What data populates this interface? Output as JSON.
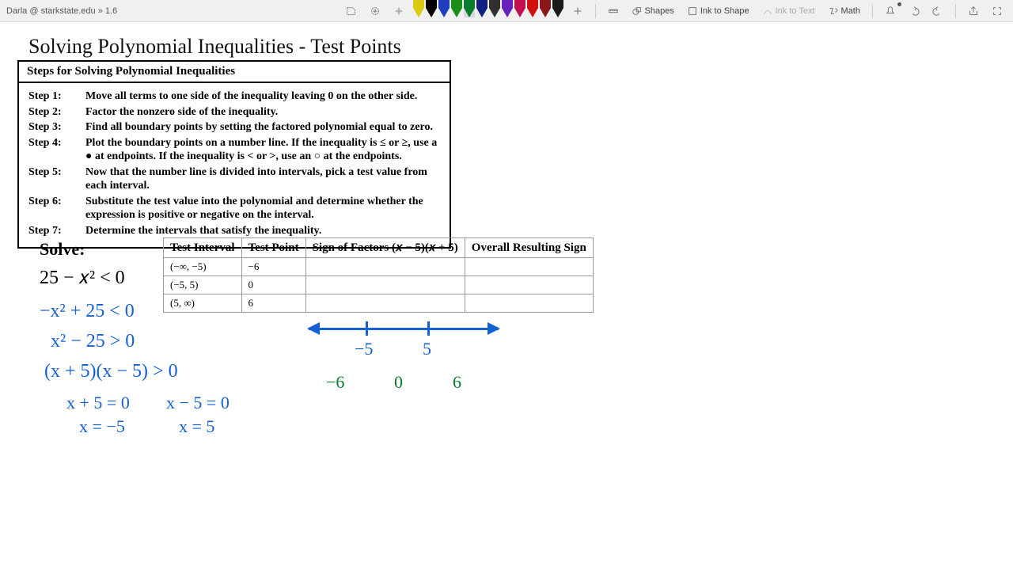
{
  "toolbar": {
    "user": "Darla @ starkstate.edu » 1.6",
    "shapes": "Shapes",
    "ink_to_shape": "Ink to Shape",
    "ink_to_text": "Ink to Text",
    "math": "Math",
    "pens": [
      {
        "color": "#d9c90f"
      },
      {
        "color": "#000000"
      },
      {
        "color": "#1f3fbf"
      },
      {
        "color": "#1a8f1a"
      },
      {
        "color": "#0a7d2c",
        "selected": true
      },
      {
        "color": "#102080"
      },
      {
        "color": "#303030"
      },
      {
        "color": "#6a1fbf"
      },
      {
        "color": "#c01050"
      },
      {
        "color": "#d01010"
      },
      {
        "color": "#8a1a1a"
      },
      {
        "color": "#1a1a1a"
      }
    ]
  },
  "page": {
    "title": "Solving Polynomial Inequalities - Test Points",
    "steps_heading": "Steps for Solving Polynomial Inequalities",
    "steps": [
      {
        "n": "Step 1:",
        "t": "Move all terms to one side of the inequality leaving 0 on the other side."
      },
      {
        "n": "Step 2:",
        "t": "Factor the nonzero side of the inequality."
      },
      {
        "n": "Step 3:",
        "t": "Find all boundary points by setting the factored polynomial equal to zero."
      },
      {
        "n": "Step 4:",
        "t": "Plot the boundary points on a number line.  If the inequality is ≤ or ≥, use a ● at endpoints. If the inequality is < or >, use an ○ at the endpoints."
      },
      {
        "n": "Step 5:",
        "t": "Now that the number line is divided into intervals, pick a test value from each interval."
      },
      {
        "n": "Step 6:",
        "t": "Substitute the test value into the polynomial and determine whether the expression is positive or negative on the interval."
      },
      {
        "n": "Step 7:",
        "t": "Determine the intervals that satisfy the inequality."
      }
    ],
    "solve_label": "Solve:",
    "solve_expr": "25 − 𝑥² < 0",
    "table": {
      "headers": [
        "Test Interval",
        "Test Point",
        "Sign of Factors (𝑥 − 5)(𝑥 + 5)",
        "Overall Resulting Sign"
      ],
      "rows": [
        {
          "interval": "(−∞, −5)",
          "point": "−6",
          "sign": "",
          "overall": ""
        },
        {
          "interval": "(−5, 5)",
          "point": "0",
          "sign": "",
          "overall": ""
        },
        {
          "interval": "(5, ∞)",
          "point": "6",
          "sign": "",
          "overall": ""
        }
      ]
    },
    "handwriting": {
      "l1": "−x² + 25 < 0",
      "l2": "x² − 25 > 0",
      "l3": "(x + 5)(x − 5) > 0",
      "l4": "x + 5 = 0",
      "l5": "x − 5 = 0",
      "l6": "x = −5",
      "l7": "x = 5",
      "nl_neg5": "−5",
      "nl_5": "5",
      "tp_neg6": "−6",
      "tp_0": "0",
      "tp_6": "6"
    }
  }
}
